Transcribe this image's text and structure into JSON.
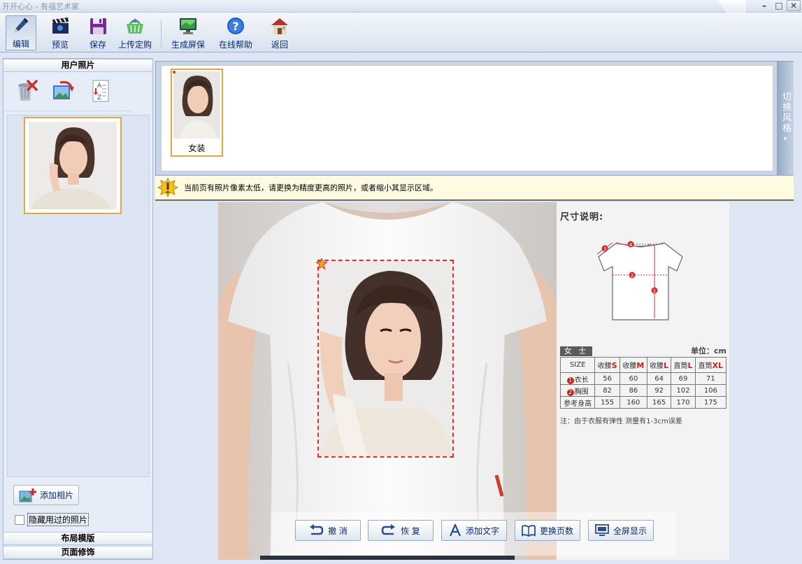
{
  "window": {
    "title": "开开心心 - 有福艺术家",
    "controls": [
      "minimize",
      "maximize",
      "close"
    ]
  },
  "toolbar": {
    "items": [
      {
        "label": "编辑",
        "icon": "pen-icon",
        "active": true
      },
      {
        "label": "预览",
        "icon": "clapper-icon",
        "active": false
      },
      {
        "label": "保存",
        "icon": "floppy-disk-icon",
        "active": false
      },
      {
        "label": "上传定购",
        "icon": "shopping-basket-icon",
        "active": false
      },
      {
        "label": "生成屏保",
        "icon": "monitor-icon",
        "active": false
      },
      {
        "label": "在线帮助",
        "icon": "help-icon",
        "active": false
      },
      {
        "label": "返回",
        "icon": "home-icon",
        "active": false
      }
    ]
  },
  "left_panel": {
    "sections": [
      "用户照片",
      "布局模版",
      "页面修饰"
    ],
    "photo_tools": [
      "recycle-bin-delete-icon",
      "rotate-photo-icon",
      "sort-az-icon"
    ],
    "add_photo_label": "添加相片",
    "hide_used_label": "隐藏用过的照片",
    "hide_used_checked": false
  },
  "style_strip": {
    "styles": [
      {
        "label": "女装"
      }
    ],
    "switch_label": "切换风格"
  },
  "warning": {
    "text": "当前页有照片像素太低，请更换为精度更高的照片，或者缩小其显示区域。"
  },
  "size_chart": {
    "title": "尺寸说明:",
    "gender": "女 士",
    "unit": "单位：cm",
    "header": [
      {
        "text": "SIZE",
        "size": ""
      },
      {
        "text": "收腰",
        "size": "S"
      },
      {
        "text": "收腰",
        "size": "M"
      },
      {
        "text": "收腰",
        "size": "L"
      },
      {
        "text": "直筒",
        "size": "L"
      },
      {
        "text": "直筒",
        "size": "XL"
      }
    ],
    "rows": [
      {
        "marker": "1",
        "label": "衣长",
        "values": [
          "56",
          "60",
          "64",
          "69",
          "71"
        ]
      },
      {
        "marker": "2",
        "label": "胸围",
        "values": [
          "82",
          "86",
          "92",
          "102",
          "106"
        ]
      },
      {
        "marker": "",
        "label": "参考身高",
        "values": [
          "155",
          "160",
          "165",
          "170",
          "175"
        ]
      }
    ],
    "diagram_markers": [
      "1",
      "2",
      "3",
      "4"
    ],
    "note": "注：由于衣服有弹性 测量有1-3cm误差"
  },
  "bottom_bar": {
    "buttons": [
      {
        "label": "撤 消",
        "icon": "undo-icon"
      },
      {
        "label": "恢 复",
        "icon": "redo-icon"
      },
      {
        "label": "添加文字",
        "icon": "add-text-icon"
      },
      {
        "label": "更换页数",
        "icon": "book-icon"
      },
      {
        "label": "全屏显示",
        "icon": "fullscreen-icon"
      }
    ]
  },
  "colors": {
    "accent_orange": "#e3a83c",
    "dashed_red": "#e0302d",
    "label_blue": "#0a2a6b",
    "panel_bg": "#e6edf6"
  }
}
